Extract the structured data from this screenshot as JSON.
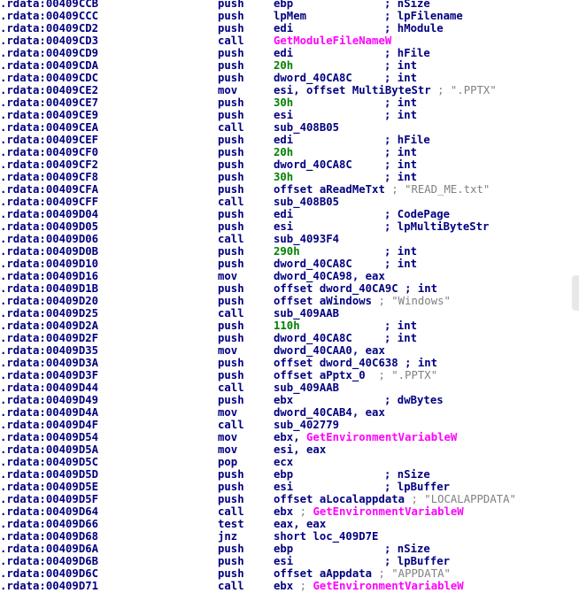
{
  "colors": {
    "addr": "#000080",
    "name": "#000080",
    "func": "#ff00ff",
    "hex": "#008000",
    "gray": "#808080"
  },
  "lines": [
    {
      "addr": ".rdata:00409CCB",
      "mnem": "push",
      "ops": [
        {
          "t": "ebp",
          "c": "n"
        }
      ],
      "cmt": [
        {
          "t": "; nSize",
          "c": "n"
        }
      ]
    },
    {
      "addr": ".rdata:00409CCC",
      "mnem": "push",
      "ops": [
        {
          "t": "lpMem",
          "c": "n"
        }
      ],
      "cmt": [
        {
          "t": "; lpFilename",
          "c": "n"
        }
      ]
    },
    {
      "addr": ".rdata:00409CD2",
      "mnem": "push",
      "ops": [
        {
          "t": "edi",
          "c": "n"
        }
      ],
      "cmt": [
        {
          "t": "; hModule",
          "c": "n"
        }
      ]
    },
    {
      "addr": ".rdata:00409CD3",
      "mnem": "call",
      "ops": [
        {
          "t": "GetModuleFileNameW",
          "c": "f"
        }
      ],
      "cmt": []
    },
    {
      "addr": ".rdata:00409CD9",
      "mnem": "push",
      "ops": [
        {
          "t": "edi",
          "c": "n"
        }
      ],
      "cmt": [
        {
          "t": "; hFile",
          "c": "n"
        }
      ]
    },
    {
      "addr": ".rdata:00409CDA",
      "mnem": "push",
      "ops": [
        {
          "t": "20h",
          "c": "h"
        }
      ],
      "cmt": [
        {
          "t": "; int",
          "c": "n"
        }
      ]
    },
    {
      "addr": ".rdata:00409CDC",
      "mnem": "push",
      "ops": [
        {
          "t": "dword_40CA8C",
          "c": "n"
        }
      ],
      "cmt": [
        {
          "t": "; int",
          "c": "n"
        }
      ]
    },
    {
      "addr": ".rdata:00409CE2",
      "mnem": "mov",
      "ops": [
        {
          "t": "esi, offset MultiByteStr ",
          "c": "n"
        },
        {
          "t": "; \".PPTX\"",
          "c": "g"
        }
      ],
      "cmt": []
    },
    {
      "addr": ".rdata:00409CE7",
      "mnem": "push",
      "ops": [
        {
          "t": "30h",
          "c": "h"
        }
      ],
      "cmt": [
        {
          "t": "; int",
          "c": "n"
        }
      ]
    },
    {
      "addr": ".rdata:00409CE9",
      "mnem": "push",
      "ops": [
        {
          "t": "esi",
          "c": "n"
        }
      ],
      "cmt": [
        {
          "t": "; int",
          "c": "n"
        }
      ]
    },
    {
      "addr": ".rdata:00409CEA",
      "mnem": "call",
      "ops": [
        {
          "t": "sub_408B05",
          "c": "n"
        }
      ],
      "cmt": []
    },
    {
      "addr": ".rdata:00409CEF",
      "mnem": "push",
      "ops": [
        {
          "t": "edi",
          "c": "n"
        }
      ],
      "cmt": [
        {
          "t": "; hFile",
          "c": "n"
        }
      ]
    },
    {
      "addr": ".rdata:00409CF0",
      "mnem": "push",
      "ops": [
        {
          "t": "20h",
          "c": "h"
        }
      ],
      "cmt": [
        {
          "t": "; int",
          "c": "n"
        }
      ]
    },
    {
      "addr": ".rdata:00409CF2",
      "mnem": "push",
      "ops": [
        {
          "t": "dword_40CA8C",
          "c": "n"
        }
      ],
      "cmt": [
        {
          "t": "; int",
          "c": "n"
        }
      ]
    },
    {
      "addr": ".rdata:00409CF8",
      "mnem": "push",
      "ops": [
        {
          "t": "30h",
          "c": "h"
        }
      ],
      "cmt": [
        {
          "t": "; int",
          "c": "n"
        }
      ]
    },
    {
      "addr": ".rdata:00409CFA",
      "mnem": "push",
      "ops": [
        {
          "t": "offset aReadMeTxt ",
          "c": "n"
        },
        {
          "t": "; \"READ_ME.txt\"",
          "c": "g"
        }
      ],
      "cmt": []
    },
    {
      "addr": ".rdata:00409CFF",
      "mnem": "call",
      "ops": [
        {
          "t": "sub_408B05",
          "c": "n"
        }
      ],
      "cmt": []
    },
    {
      "addr": ".rdata:00409D04",
      "mnem": "push",
      "ops": [
        {
          "t": "edi",
          "c": "n"
        }
      ],
      "cmt": [
        {
          "t": "; CodePage",
          "c": "n"
        }
      ]
    },
    {
      "addr": ".rdata:00409D05",
      "mnem": "push",
      "ops": [
        {
          "t": "esi",
          "c": "n"
        }
      ],
      "cmt": [
        {
          "t": "; lpMultiByteStr",
          "c": "n"
        }
      ]
    },
    {
      "addr": ".rdata:00409D06",
      "mnem": "call",
      "ops": [
        {
          "t": "sub_4093F4",
          "c": "n"
        }
      ],
      "cmt": []
    },
    {
      "addr": ".rdata:00409D0B",
      "mnem": "push",
      "ops": [
        {
          "t": "290h",
          "c": "h"
        }
      ],
      "cmt": [
        {
          "t": "; int",
          "c": "n"
        }
      ]
    },
    {
      "addr": ".rdata:00409D10",
      "mnem": "push",
      "ops": [
        {
          "t": "dword_40CA8C",
          "c": "n"
        }
      ],
      "cmt": [
        {
          "t": "; int",
          "c": "n"
        }
      ]
    },
    {
      "addr": ".rdata:00409D16",
      "mnem": "mov",
      "ops": [
        {
          "t": "dword_40CA98, eax",
          "c": "n"
        }
      ],
      "cmt": []
    },
    {
      "addr": ".rdata:00409D1B",
      "mnem": "push",
      "ops": [
        {
          "t": "offset dword_40CA9C ; int",
          "c": "n"
        }
      ],
      "cmt": []
    },
    {
      "addr": ".rdata:00409D20",
      "mnem": "push",
      "ops": [
        {
          "t": "offset aWindows ",
          "c": "n"
        },
        {
          "t": "; \"Windows\"",
          "c": "g"
        }
      ],
      "cmt": []
    },
    {
      "addr": ".rdata:00409D25",
      "mnem": "call",
      "ops": [
        {
          "t": "sub_409AAB",
          "c": "n"
        }
      ],
      "cmt": []
    },
    {
      "addr": ".rdata:00409D2A",
      "mnem": "push",
      "ops": [
        {
          "t": "110h",
          "c": "h"
        }
      ],
      "cmt": [
        {
          "t": "; int",
          "c": "n"
        }
      ]
    },
    {
      "addr": ".rdata:00409D2F",
      "mnem": "push",
      "ops": [
        {
          "t": "dword_40CA8C",
          "c": "n"
        }
      ],
      "cmt": [
        {
          "t": "; int",
          "c": "n"
        }
      ]
    },
    {
      "addr": ".rdata:00409D35",
      "mnem": "mov",
      "ops": [
        {
          "t": "dword_40CAA0, eax",
          "c": "n"
        }
      ],
      "cmt": []
    },
    {
      "addr": ".rdata:00409D3A",
      "mnem": "push",
      "ops": [
        {
          "t": "offset dword_40C638 ; int",
          "c": "n"
        }
      ],
      "cmt": []
    },
    {
      "addr": ".rdata:00409D3F",
      "mnem": "push",
      "ops": [
        {
          "t": "offset aPptx_0  ",
          "c": "n"
        },
        {
          "t": "; \".PPTX\"",
          "c": "g"
        }
      ],
      "cmt": []
    },
    {
      "addr": ".rdata:00409D44",
      "mnem": "call",
      "ops": [
        {
          "t": "sub_409AAB",
          "c": "n"
        }
      ],
      "cmt": []
    },
    {
      "addr": ".rdata:00409D49",
      "mnem": "push",
      "ops": [
        {
          "t": "ebx",
          "c": "n"
        }
      ],
      "cmt": [
        {
          "t": "; dwBytes",
          "c": "n"
        }
      ]
    },
    {
      "addr": ".rdata:00409D4A",
      "mnem": "mov",
      "ops": [
        {
          "t": "dword_40CAB4, eax",
          "c": "n"
        }
      ],
      "cmt": []
    },
    {
      "addr": ".rdata:00409D4F",
      "mnem": "call",
      "ops": [
        {
          "t": "sub_402779",
          "c": "n"
        }
      ],
      "cmt": []
    },
    {
      "addr": ".rdata:00409D54",
      "mnem": "mov",
      "ops": [
        {
          "t": "ebx, ",
          "c": "n"
        },
        {
          "t": "GetEnvironmentVariableW",
          "c": "f"
        }
      ],
      "cmt": []
    },
    {
      "addr": ".rdata:00409D5A",
      "mnem": "mov",
      "ops": [
        {
          "t": "esi, eax",
          "c": "n"
        }
      ],
      "cmt": []
    },
    {
      "addr": ".rdata:00409D5C",
      "mnem": "pop",
      "ops": [
        {
          "t": "ecx",
          "c": "n"
        }
      ],
      "cmt": []
    },
    {
      "addr": ".rdata:00409D5D",
      "mnem": "push",
      "ops": [
        {
          "t": "ebp",
          "c": "n"
        }
      ],
      "cmt": [
        {
          "t": "; nSize",
          "c": "n"
        }
      ]
    },
    {
      "addr": ".rdata:00409D5E",
      "mnem": "push",
      "ops": [
        {
          "t": "esi",
          "c": "n"
        }
      ],
      "cmt": [
        {
          "t": "; lpBuffer",
          "c": "n"
        }
      ]
    },
    {
      "addr": ".rdata:00409D5F",
      "mnem": "push",
      "ops": [
        {
          "t": "offset aLocalappdata ",
          "c": "n"
        },
        {
          "t": "; \"LOCALAPPDATA\"",
          "c": "g"
        }
      ],
      "cmt": []
    },
    {
      "addr": ".rdata:00409D64",
      "mnem": "call",
      "ops": [
        {
          "t": "ebx ",
          "c": "n"
        },
        {
          "t": "; ",
          "c": "g"
        },
        {
          "t": "GetEnvironmentVariableW",
          "c": "f"
        }
      ],
      "cmt": []
    },
    {
      "addr": ".rdata:00409D66",
      "mnem": "test",
      "ops": [
        {
          "t": "eax, eax",
          "c": "n"
        }
      ],
      "cmt": []
    },
    {
      "addr": ".rdata:00409D68",
      "mnem": "jnz",
      "ops": [
        {
          "t": "short loc_409D7E",
          "c": "n"
        }
      ],
      "cmt": []
    },
    {
      "addr": ".rdata:00409D6A",
      "mnem": "push",
      "ops": [
        {
          "t": "ebp",
          "c": "n"
        }
      ],
      "cmt": [
        {
          "t": "; nSize",
          "c": "n"
        }
      ]
    },
    {
      "addr": ".rdata:00409D6B",
      "mnem": "push",
      "ops": [
        {
          "t": "esi",
          "c": "n"
        }
      ],
      "cmt": [
        {
          "t": "; lpBuffer",
          "c": "n"
        }
      ]
    },
    {
      "addr": ".rdata:00409D6C",
      "mnem": "push",
      "ops": [
        {
          "t": "offset aAppdata ",
          "c": "n"
        },
        {
          "t": "; \"APPDATA\"",
          "c": "g"
        }
      ],
      "cmt": []
    },
    {
      "addr": ".rdata:00409D71",
      "mnem": "call",
      "ops": [
        {
          "t": "ebx ",
          "c": "n"
        },
        {
          "t": "; ",
          "c": "g"
        },
        {
          "t": "GetEnvironmentVariableW",
          "c": "f"
        }
      ],
      "cmt": []
    }
  ]
}
